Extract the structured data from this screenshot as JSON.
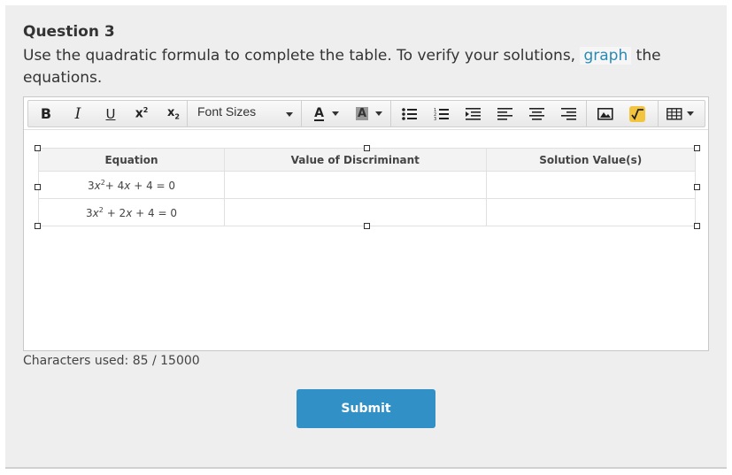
{
  "question": {
    "title": "Question 3",
    "text_before_link": "Use the quadratic formula to complete the table. To verify your solutions,",
    "link_text": "graph",
    "text_after_link": "the equations."
  },
  "toolbar": {
    "bold_label": "B",
    "italic_label": "I",
    "underline_label": "U",
    "superscript_label": "x",
    "subscript_label": "x",
    "font_sizes_label": "Font Sizes",
    "font_color_label": "A",
    "highlight_label": "A",
    "icons": [
      "bold-icon",
      "italic-icon",
      "underline-icon",
      "superscript-icon",
      "subscript-icon",
      "text-color-icon",
      "background-color-icon",
      "bullet-list-icon",
      "numbered-list-icon",
      "indent-icon",
      "align-left-icon",
      "align-center-icon",
      "align-right-icon",
      "image-icon",
      "math-equation-icon",
      "table-icon"
    ]
  },
  "table": {
    "headers": [
      "Equation",
      "Value of Discriminant",
      "Solution Value(s)"
    ],
    "rows": [
      {
        "eq_coef": "3",
        "eq_var": "x",
        "eq_exp": "2",
        "eq_rest_a": "+ 4",
        "eq_var2": "x",
        "eq_rest_b": " + 4 = 0",
        "discriminant": "",
        "solution": ""
      },
      {
        "eq_coef": "3",
        "eq_var": "x",
        "eq_exp": "2",
        "eq_rest_a": " + 2",
        "eq_var2": "x",
        "eq_rest_b": " + 4 = 0",
        "discriminant": "",
        "solution": ""
      }
    ]
  },
  "characters_used": "Characters used: 85 / 15000",
  "submit_label": "Submit",
  "colors": {
    "link": "#2a8ab5",
    "submit": "#3191c7",
    "formula_icon": "#f3c43e"
  }
}
